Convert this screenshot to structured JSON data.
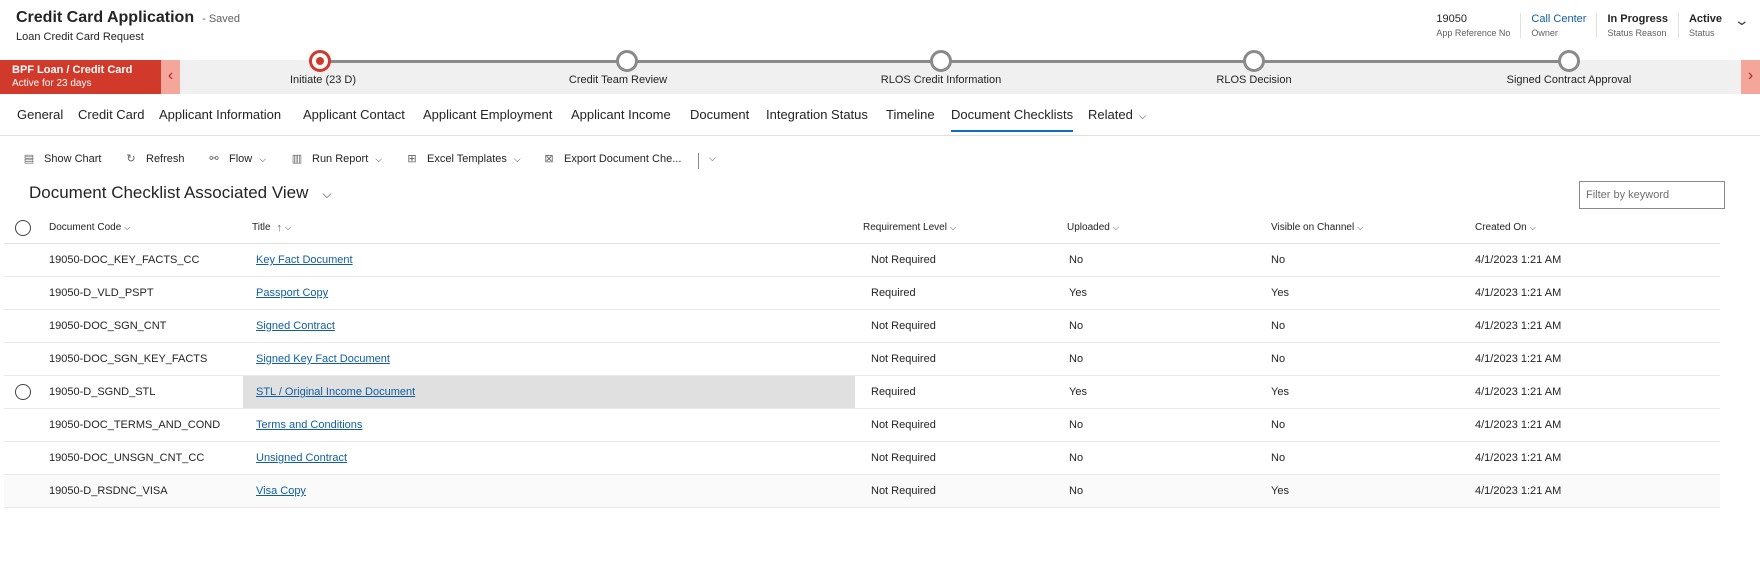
{
  "record": {
    "title": "Credit Card Application",
    "saved_status": "- Saved",
    "subtitle": "Loan Credit Card Request",
    "fields": [
      {
        "value": "19050",
        "label": "App Reference No"
      },
      {
        "value": "Call Center",
        "label": "Owner"
      },
      {
        "value": "In Progress",
        "label": "Status Reason"
      },
      {
        "value": "Active",
        "label": "Status"
      }
    ]
  },
  "bpf": {
    "stage_name": "BPF Loan / Credit Card",
    "stage_duration": "Active for 23 days",
    "stages": [
      {
        "label": "Initiate  (23 D)",
        "active": true
      },
      {
        "label": "Credit Team Review",
        "active": false
      },
      {
        "label": "RLOS Credit Information",
        "active": false
      },
      {
        "label": "RLOS Decision",
        "active": false
      },
      {
        "label": "Signed Contract Approval",
        "active": false
      }
    ]
  },
  "tabs": [
    "General",
    "Credit Card",
    "Applicant Information",
    "Applicant Contact",
    "Applicant Employment",
    "Applicant Income",
    "Document",
    "Integration Status",
    "Timeline",
    "Document Checklists",
    "Related"
  ],
  "selected_tab": "Document Checklists",
  "commands": [
    {
      "label": "Show Chart",
      "icon": "chart-icon"
    },
    {
      "label": "Refresh",
      "icon": "refresh-icon"
    },
    {
      "label": "Flow",
      "icon": "flow-icon"
    },
    {
      "label": "Run Report",
      "icon": "report-icon"
    },
    {
      "label": "Excel Templates",
      "icon": "excel-icon"
    },
    {
      "label": "Export Document Che...",
      "icon": "export-excel-icon"
    }
  ],
  "view": {
    "title": "Document Checklist Associated View",
    "filter_placeholder": "Filter by keyword"
  },
  "grid": {
    "columns": [
      "Document Code",
      "Title",
      "Requirement Level",
      "Uploaded",
      "Visible on Channel",
      "Created On"
    ],
    "sort_indicator": "↑",
    "rows": [
      {
        "code": "19050-DOC_KEY_FACTS_CC",
        "title": "Key Fact Document",
        "req": "Not Required",
        "uploaded": "No",
        "visible": "No",
        "created": "4/1/2023 1:21 AM"
      },
      {
        "code": "19050-D_VLD_PSPT",
        "title": "Passport Copy",
        "req": "Required",
        "uploaded": "Yes",
        "visible": "Yes",
        "created": "4/1/2023 1:21 AM"
      },
      {
        "code": "19050-DOC_SGN_CNT",
        "title": "Signed Contract",
        "req": "Not Required",
        "uploaded": "No",
        "visible": "No",
        "created": "4/1/2023 1:21 AM"
      },
      {
        "code": "19050-DOC_SGN_KEY_FACTS",
        "title": "Signed Key Fact Document",
        "req": "Not Required",
        "uploaded": "No",
        "visible": "No",
        "created": "4/1/2023 1:21 AM"
      },
      {
        "code": "19050-D_SGND_STL",
        "title": "STL / Original Income Document",
        "req": "Required",
        "uploaded": "Yes",
        "visible": "Yes",
        "created": "4/1/2023 1:21 AM"
      },
      {
        "code": "19050-DOC_TERMS_AND_COND",
        "title": "Terms and Conditions",
        "req": "Not Required",
        "uploaded": "No",
        "visible": "No",
        "created": "4/1/2023 1:21 AM"
      },
      {
        "code": "19050-DOC_UNSGN_CNT_CC",
        "title": "Unsigned Contract",
        "req": "Not Required",
        "uploaded": "No",
        "visible": "No",
        "created": "4/1/2023 1:21 AM"
      },
      {
        "code": "19050-D_RSDNC_VISA",
        "title": "Visa Copy",
        "req": "Not Required",
        "uploaded": "No",
        "visible": "Yes",
        "created": "4/1/2023 1:21 AM"
      }
    ]
  },
  "colors": {
    "accent": "#0f6cbd",
    "stage": "#d13a2a",
    "link": "#115ea3"
  }
}
